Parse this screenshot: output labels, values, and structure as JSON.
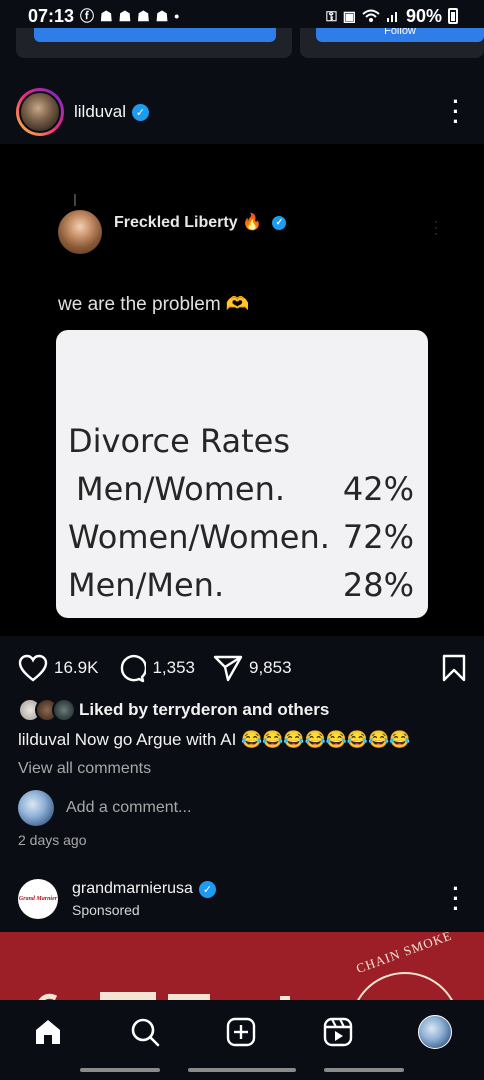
{
  "status_bar": {
    "time": "07:13",
    "notification_icons": [
      "facebook-icon",
      "snapchat-icon",
      "snapchat-icon",
      "snapchat-icon",
      "snapchat-icon",
      "dot-icon"
    ],
    "right_icons": [
      "key-icon",
      "battery-saver-icon",
      "wifi-icon",
      "signal-icon"
    ],
    "battery": "90%"
  },
  "previous_post": {
    "button_label": "Follow"
  },
  "post": {
    "username": "lilduval",
    "verified": true,
    "embedded_tweet": {
      "author": "Freckled Liberty",
      "author_emoji": "🔥",
      "text": "we are the problem 🫶",
      "card": {
        "title": "Divorce Rates",
        "rows": [
          {
            "label": "Men/Women.",
            "value": "42%"
          },
          {
            "label": "Women/Women.",
            "value": "72%"
          },
          {
            "label": "Men/Men.",
            "value": "28%"
          }
        ]
      }
    },
    "likes_count": "16.9K",
    "comments_count": "1,353",
    "shares_count": "9,853",
    "liked_by": "Liked by terryderon and others",
    "caption_user": "lilduval",
    "caption_text": "Now go Argue with AI",
    "caption_emojis": "😂😂😂😂😂😂😂😂",
    "view_comments": "View all comments",
    "add_comment_placeholder": "Add a comment...",
    "time_ago": "2 days ago"
  },
  "sponsored_post": {
    "avatar_text": "Grand Marnier",
    "username": "grandmarnierusa",
    "verified": true,
    "label": "Sponsored",
    "ad_badge": "CHAIN SMOKE"
  },
  "bottom_nav": {
    "items": [
      "home-icon",
      "search-icon",
      "create-icon",
      "reels-icon",
      "profile-avatar"
    ]
  },
  "colors": {
    "background": "#0b0d14",
    "verified_blue": "#1d9bf0",
    "ad_red": "#9c1f27"
  }
}
